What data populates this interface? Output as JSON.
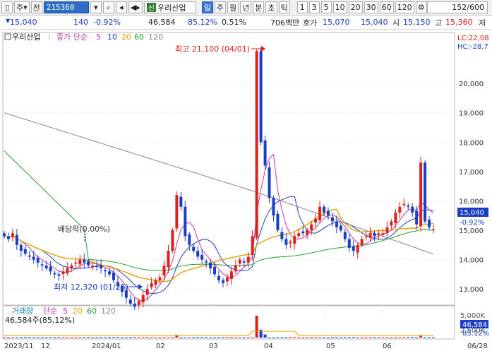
{
  "toolbar": {
    "market": "주",
    "prefix": "전",
    "code": "215360",
    "sign": "신",
    "name": "우리산업",
    "periods": [
      {
        "label": "일",
        "active": true
      },
      {
        "label": "주",
        "active": false
      },
      {
        "label": "월",
        "active": false
      },
      {
        "label": "년",
        "active": false
      },
      {
        "label": "분",
        "active": false
      },
      {
        "label": "초",
        "active": false
      },
      {
        "label": "틱",
        "active": false
      }
    ],
    "intervals": [
      "1",
      "3",
      "5",
      "10",
      "20",
      "30",
      "60",
      "120"
    ],
    "count": "152/600"
  },
  "info": {
    "price": "15,040",
    "change": "140",
    "change_pct": "-0.92%",
    "volume": "46,584",
    "vol_ratio": "85.12%",
    "turnover_pct": "0.51%",
    "amount": "706백만",
    "quote_label": "호가",
    "ask": "15,070",
    "bid": "15,040",
    "open_label": "시",
    "open": "15,150",
    "high_label": "고",
    "high": "15,360",
    "low_label": "저"
  },
  "price_panel": {
    "legend_name": "우리산업",
    "ma_label": "종가 단순",
    "ma_periods": [
      "5",
      "10",
      "20",
      "60",
      "120"
    ],
    "lc": "LC:22,08",
    "hc": "HC:-28,7",
    "max_annotation": "최고 21,100 (04/01)",
    "min_annotation": "최저 12,320 (01/26)",
    "dividend": "배당락(0.00%)",
    "last_price": "15,040",
    "last_pct": "-0.92%",
    "y_ticks": [
      "20,000",
      "19,000",
      "18,000",
      "17,000",
      "16,000",
      "15,000",
      "14,000",
      "13,000"
    ]
  },
  "volume_panel": {
    "legend_name": "거래량",
    "ma_label": "단순",
    "ma_periods": [
      "5",
      "20",
      "60",
      "120"
    ],
    "current": "46,584주(85,12%)",
    "y_ticks": [
      "5,000K",
      "2,500K"
    ],
    "last_vol": "46,584",
    "last_pct": "85.12%"
  },
  "x_axis": [
    "2023/11",
    "12",
    "2024/01",
    "02",
    "03",
    "04",
    "05",
    "06",
    "06/28"
  ],
  "colors": {
    "up": "#e0201a",
    "down": "#1a3fc4",
    "ma5": "#c23ab0",
    "ma10": "#2040c0",
    "ma20": "#e6a100",
    "ma60": "#2e9a2e",
    "ma120": "#888888"
  },
  "chart_data": {
    "type": "candlestick",
    "ylim": [
      12500,
      21300
    ],
    "y_ticks": [
      13000,
      14000,
      15000,
      16000,
      17000,
      18000,
      19000,
      20000
    ],
    "x_labels": [
      "2023/11",
      "12",
      "2024/01",
      "02",
      "03",
      "04",
      "05",
      "06",
      "06/28"
    ],
    "max_point": {
      "label": "04/01",
      "value": 21100
    },
    "min_point": {
      "label": "01/26",
      "value": 12320
    },
    "last_close": 15040,
    "ohlc_close_approx": [
      14800,
      14700,
      14900,
      14500,
      14300,
      14200,
      14100,
      14000,
      13900,
      13800,
      13700,
      13600,
      13500,
      13450,
      13600,
      13700,
      13800,
      13900,
      14000,
      13900,
      13800,
      13800,
      13750,
      13700,
      13600,
      13500,
      13300,
      13100,
      12900,
      12700,
      12500,
      12400,
      12600,
      12800,
      13000,
      13200,
      13300,
      13400,
      13800,
      14300,
      15000,
      16200,
      15800,
      14800,
      14500,
      14300,
      14100,
      14000,
      13900,
      13700,
      13500,
      13300,
      13200,
      13400,
      13600,
      13800,
      14000,
      13900,
      14100,
      14800,
      21100,
      18000,
      17200,
      16100,
      15500,
      15000,
      14700,
      14500,
      14600,
      14800,
      14900,
      14900,
      15000,
      15200,
      15400,
      15800,
      15600,
      15500,
      15300,
      15100,
      15000,
      14700,
      14400,
      14300,
      14500,
      14700,
      14800,
      14900,
      14800,
      14900,
      14900,
      15100,
      15300,
      15600,
      15800,
      15900,
      15800,
      15600,
      15200,
      17300,
      15300,
      15100,
      15040
    ],
    "volume_spikes": [
      {
        "label": "02",
        "value_k": 600
      },
      {
        "label": "04",
        "value_k": 5000
      },
      {
        "label": "06",
        "value_k": 500
      }
    ]
  }
}
